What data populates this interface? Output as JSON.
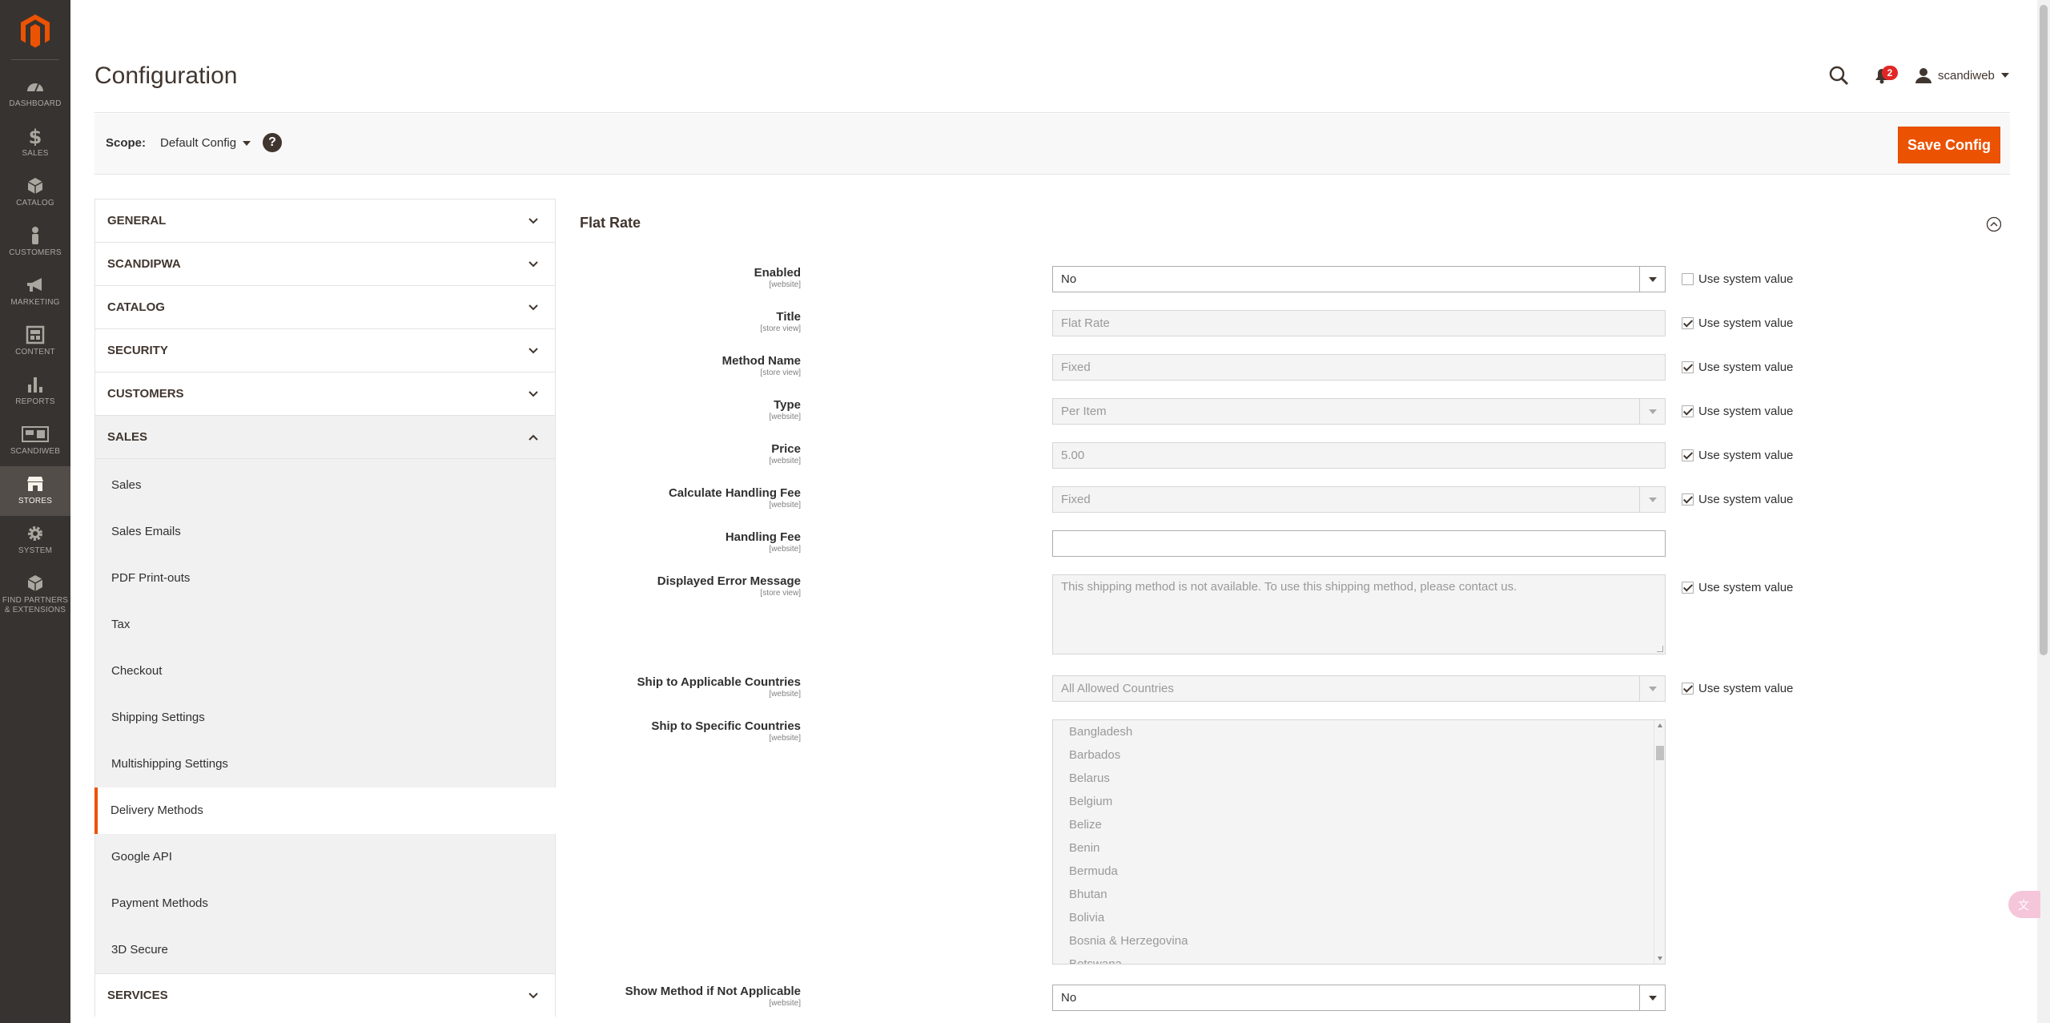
{
  "menu": {
    "items": [
      {
        "key": "dashboard",
        "label": "DASHBOARD",
        "icon": "dashboard-icon"
      },
      {
        "key": "sales",
        "label": "SALES",
        "icon": "dollar-icon"
      },
      {
        "key": "catalog",
        "label": "CATALOG",
        "icon": "cube-icon"
      },
      {
        "key": "customers",
        "label": "CUSTOMERS",
        "icon": "person-icon"
      },
      {
        "key": "marketing",
        "label": "MARKETING",
        "icon": "megaphone-icon"
      },
      {
        "key": "content",
        "label": "CONTENT",
        "icon": "layout-icon"
      },
      {
        "key": "reports",
        "label": "REPORTS",
        "icon": "bar-chart-icon"
      },
      {
        "key": "scandiweb",
        "label": "SCANDIWEB",
        "icon": "scandiweb-icon"
      },
      {
        "key": "stores",
        "label": "STORES",
        "icon": "store-icon",
        "active": true
      },
      {
        "key": "system",
        "label": "SYSTEM",
        "icon": "gear-icon"
      },
      {
        "key": "partners",
        "label": "FIND PARTNERS & EXTENSIONS",
        "icon": "box-icon"
      }
    ]
  },
  "header": {
    "title": "Configuration",
    "notifications_count": "2",
    "username": "scandiweb"
  },
  "scope": {
    "label": "Scope:",
    "value": "Default Config",
    "help": "?",
    "save_label": "Save Config"
  },
  "tabs": {
    "general": "GENERAL",
    "scandipwa": "SCANDIPWA",
    "catalog": "CATALOG",
    "security": "SECURITY",
    "customers": "CUSTOMERS",
    "sales": "SALES",
    "sales_items": [
      "Sales",
      "Sales Emails",
      "PDF Print-outs",
      "Tax",
      "Checkout",
      "Shipping Settings",
      "Multishipping Settings",
      "Delivery Methods",
      "Google API",
      "Payment Methods",
      "3D Secure"
    ],
    "services": "SERVICES"
  },
  "section": {
    "title": "Flat Rate",
    "use_system_value": "Use system value",
    "fields": {
      "enabled": {
        "label": "Enabled",
        "scope": "[website]",
        "value": "No"
      },
      "title": {
        "label": "Title",
        "scope": "[store view]",
        "value": "Flat Rate"
      },
      "method_name": {
        "label": "Method Name",
        "scope": "[store view]",
        "value": "Fixed"
      },
      "type": {
        "label": "Type",
        "scope": "[website]",
        "value": "Per Item"
      },
      "price": {
        "label": "Price",
        "scope": "[website]",
        "value": "5.00"
      },
      "calc_handling_fee": {
        "label": "Calculate Handling Fee",
        "scope": "[website]",
        "value": "Fixed"
      },
      "handling_fee": {
        "label": "Handling Fee",
        "scope": "[website]",
        "value": ""
      },
      "error_message": {
        "label": "Displayed Error Message",
        "scope": "[store view]",
        "value": "This shipping method is not available. To use this shipping method, please contact us."
      },
      "applicable_countries": {
        "label": "Ship to Applicable Countries",
        "scope": "[website]",
        "value": "All Allowed Countries"
      },
      "specific_countries": {
        "label": "Ship to Specific Countries",
        "scope": "[website]",
        "options": [
          "Bangladesh",
          "Barbados",
          "Belarus",
          "Belgium",
          "Belize",
          "Benin",
          "Bermuda",
          "Bhutan",
          "Bolivia",
          "Bosnia & Herzegovina",
          "Botswana"
        ]
      },
      "show_method": {
        "label": "Show Method if Not Applicable",
        "scope": "[website]",
        "value": "No"
      }
    }
  }
}
